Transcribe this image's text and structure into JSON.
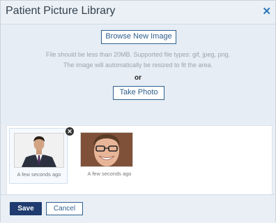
{
  "dialog": {
    "title": "Patient Picture Library",
    "close_icon": "close-icon"
  },
  "upload": {
    "browse_label": "Browse New Image",
    "info_line1": "File should be less than 20MB. Supported file types: gif, jpeg, png.",
    "info_line2": "The image will automatically be resized to fit the area.",
    "or_label": "or",
    "take_photo_label": "Take Photo"
  },
  "gallery": {
    "items": [
      {
        "caption": "A few seconds ago",
        "selected": true,
        "image": "man-in-suit-photo"
      },
      {
        "caption": "A few seconds ago",
        "selected": false,
        "image": "smiling-man-photo"
      }
    ]
  },
  "footer": {
    "save_label": "Save",
    "cancel_label": "Cancel"
  },
  "colors": {
    "primary": "#1f3b6f",
    "link": "#2c77b8"
  }
}
